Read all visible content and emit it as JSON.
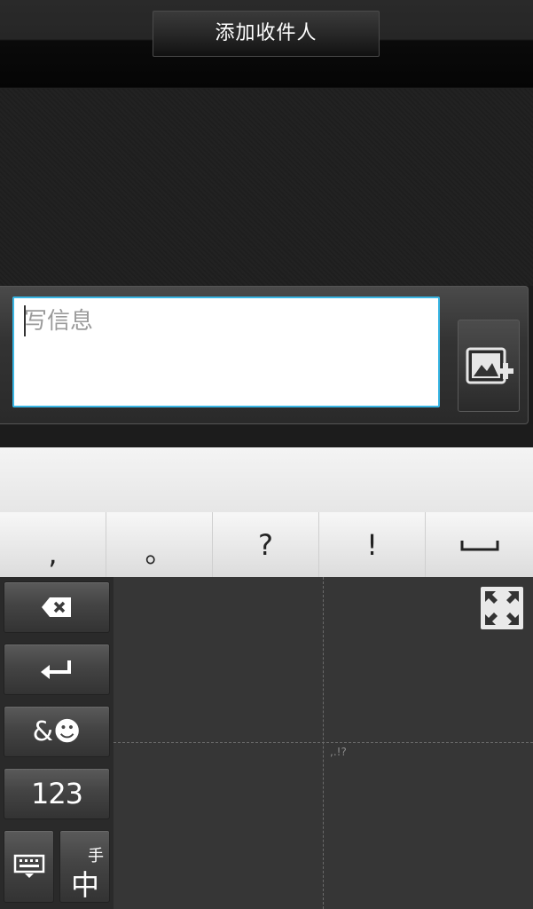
{
  "header": {
    "add_recipient_label": "添加收件人"
  },
  "compose": {
    "placeholder": "写信息"
  },
  "keyboard": {
    "punctuation": [
      ",",
      "。",
      "?",
      "!",
      "␣"
    ],
    "delete_label": "⌫",
    "symbols_label": "&☻",
    "numbers_label": "123",
    "handwriting_small": "手",
    "handwriting_main": "中",
    "handwriting_punct_hint": ",.!?"
  },
  "icons": [
    "attach-image-icon",
    "backspace-icon",
    "enter-icon",
    "keyboard-switch-icon",
    "fullscreen-icon"
  ],
  "colors": {
    "input_border": "#39b6e4",
    "keyboard_bg": "#363636"
  }
}
